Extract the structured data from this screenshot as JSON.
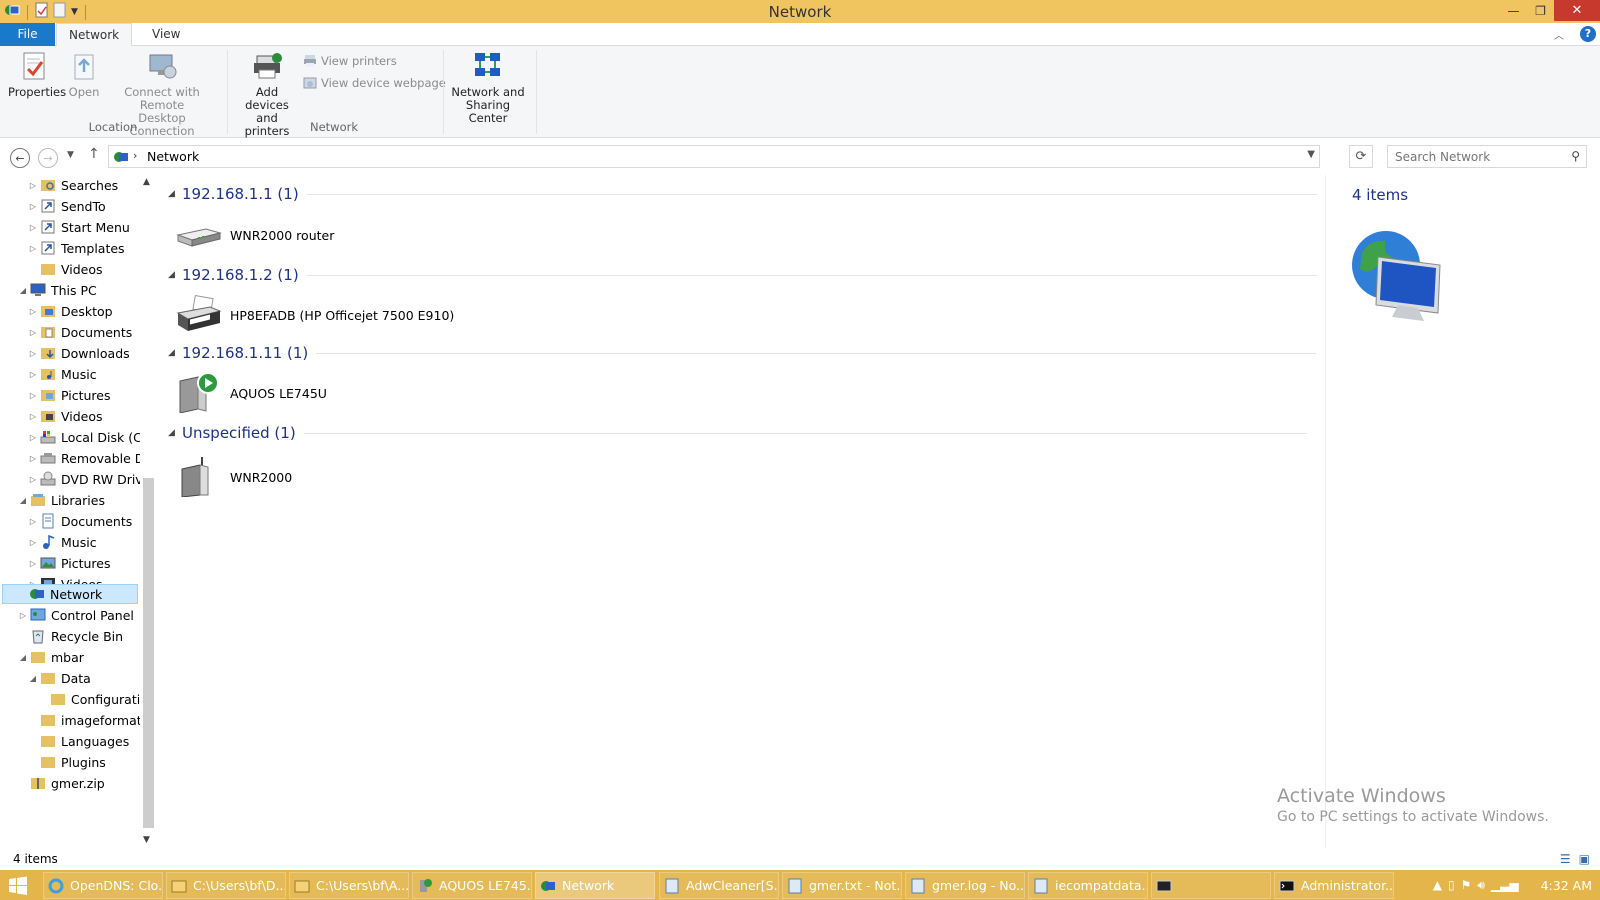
{
  "window": {
    "title": "Network"
  },
  "ribbon": {
    "tabs": [
      {
        "label": "File"
      },
      {
        "label": "Network"
      },
      {
        "label": "View"
      }
    ],
    "buttons": {
      "properties": "Properties",
      "open": "Open",
      "connect_rdc_line1": "Connect with Remote",
      "connect_rdc_line2": "Desktop Connection",
      "view_printers": "View printers",
      "view_device_webpage": "View device webpage",
      "add_devices_line1": "Add devices",
      "add_devices_line2": "and printers",
      "nsc_line1": "Network and",
      "nsc_line2": "Sharing Center"
    },
    "groups": {
      "location": "Location",
      "network": "Network"
    },
    "help": "?"
  },
  "address": {
    "crumb": "Network",
    "search_placeholder": "Search Network"
  },
  "nav_tree": [
    {
      "label": "Searches"
    },
    {
      "label": "SendTo"
    },
    {
      "label": "Start Menu"
    },
    {
      "label": "Templates"
    },
    {
      "label": "Videos"
    },
    {
      "label": "This PC"
    },
    {
      "label": "Desktop"
    },
    {
      "label": "Documents"
    },
    {
      "label": "Downloads"
    },
    {
      "label": "Music"
    },
    {
      "label": "Pictures"
    },
    {
      "label": "Videos"
    },
    {
      "label": "Local Disk (C:)"
    },
    {
      "label": "Removable Dis"
    },
    {
      "label": "DVD RW Drive ("
    },
    {
      "label": "Libraries"
    },
    {
      "label": "Documents"
    },
    {
      "label": "Music"
    },
    {
      "label": "Pictures"
    },
    {
      "label": "Videos"
    },
    {
      "label": "Network"
    },
    {
      "label": "Control Panel"
    },
    {
      "label": "Recycle Bin"
    },
    {
      "label": "mbar"
    },
    {
      "label": "Data"
    },
    {
      "label": "Configuratio"
    },
    {
      "label": "imageformats"
    },
    {
      "label": "Languages"
    },
    {
      "label": "Plugins"
    },
    {
      "label": "gmer.zip"
    }
  ],
  "groups": [
    {
      "header": "192.168.1.1 (1)",
      "device": "WNR2000 router",
      "icon": "router-icon"
    },
    {
      "header": "192.168.1.2 (1)",
      "device": "HP8EFADB (HP Officejet 7500 E910)",
      "icon": "printer-icon"
    },
    {
      "header": "192.168.1.11 (1)",
      "device": "AQUOS LE745U",
      "icon": "media-device-icon"
    },
    {
      "header": "Unspecified (1)",
      "device": "WNR2000",
      "icon": "wireless-router-icon"
    }
  ],
  "details": {
    "count": "4 items"
  },
  "watermark": {
    "line1": "Activate Windows",
    "line2": "Go to PC settings to activate Windows."
  },
  "status": {
    "text": "4 items"
  },
  "taskbar": {
    "items": [
      {
        "label": "OpenDNS: Clo..."
      },
      {
        "label": "C:\\Users\\bf\\D..."
      },
      {
        "label": "C:\\Users\\bf\\A..."
      },
      {
        "label": "AQUOS LE745..."
      },
      {
        "label": "Network"
      },
      {
        "label": "AdwCleaner[S..."
      },
      {
        "label": "gmer.txt - Not..."
      },
      {
        "label": "gmer.log - No..."
      },
      {
        "label": "iecompatdata..."
      },
      {
        "label": ""
      },
      {
        "label": "Administrator..."
      }
    ],
    "clock": "4:32 AM"
  },
  "colors": {
    "titlebar": "#f0c560",
    "taskbar": "#e3b54a",
    "file_tab": "#1979ca",
    "group_header": "#1e3287",
    "selection": "#cce8ff"
  }
}
